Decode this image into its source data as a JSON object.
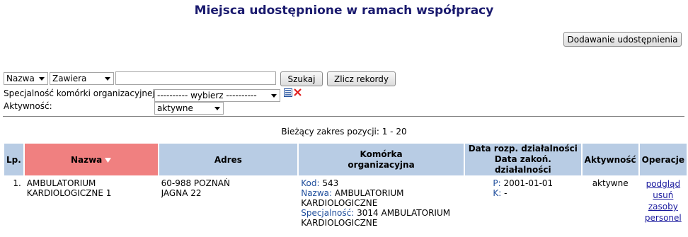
{
  "page": {
    "title": "Miejsca udostępnione w ramach współpracy"
  },
  "toolbar": {
    "add_label": "Dodawanie udostępnienia"
  },
  "filters": {
    "field_value": "Nazwa",
    "mode_value": "Zawiera",
    "search_value": "",
    "search_label": "Szukaj",
    "count_label": "Zlicz rekordy",
    "specialty_label": "Specjalność komórki organizacyjnej:",
    "specialty_value": "---------- wybierz ----------",
    "activity_label": "Aktywność:",
    "activity_value": "aktywne"
  },
  "range": "Bieżący zakres pozycji: 1 - 20",
  "table": {
    "headers": {
      "lp": "Lp.",
      "nazwa": "Nazwa",
      "adres": "Adres",
      "komorka_1": "Komórka",
      "komorka_2": "organizacyjna",
      "data_1": "Data rozp. działalności",
      "data_2": "Data zakoń. działalności",
      "aktywnosc": "Aktywność",
      "operacje": "Operacje"
    },
    "rows": [
      {
        "lp": "1.",
        "nazwa_1": "AMBULATORIUM",
        "nazwa_2": "KARDIOLOGICZNE 1",
        "adres_1": "60-988 POZNAŃ",
        "adres_2": "JAGNA 22",
        "kod_label": "Kod:",
        "kod": "543",
        "nazwa_label": "Nazwa:",
        "nazwa_value_1": "AMBULATORIUM",
        "nazwa_value_2": "KARDIOLOGICZNE",
        "spec_label": "Specjalność:",
        "spec_value_1": "3014 AMBULATORIUM",
        "spec_value_2": "KARDIOLOGICZNE",
        "p_label": "P:",
        "p_value": "2001-01-01",
        "k_label": "K:",
        "k_value": "-",
        "aktywnosc": "aktywne",
        "ops": [
          "podgląd",
          "usuń",
          "zasoby",
          "personel"
        ]
      }
    ]
  }
}
